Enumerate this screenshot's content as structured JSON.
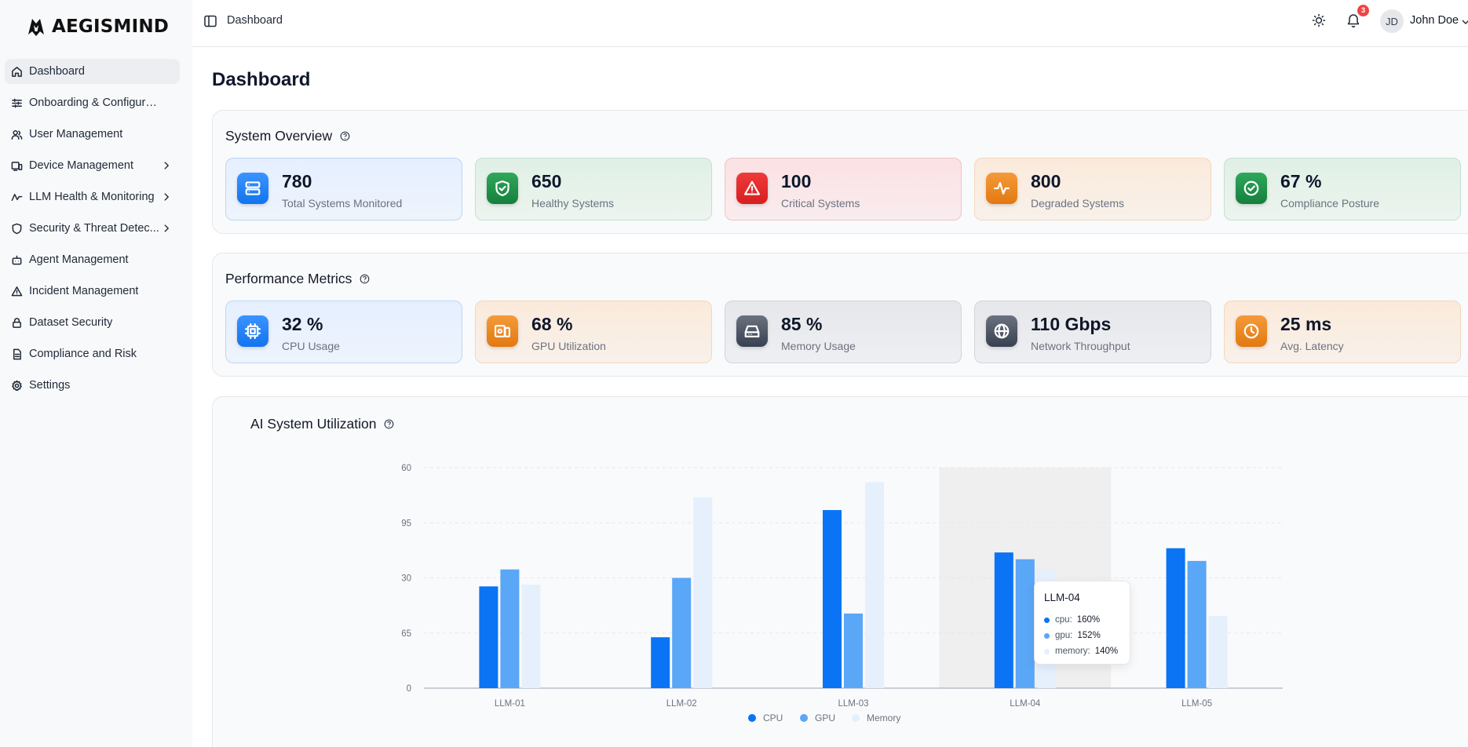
{
  "app": {
    "name": "AEGISMIND"
  },
  "sidebar": {
    "items": [
      {
        "label": "Dashboard",
        "icon": "home-icon",
        "active": true
      },
      {
        "label": "Onboarding & Configuration",
        "icon": "sliders-icon"
      },
      {
        "label": "User Management",
        "icon": "users-icon"
      },
      {
        "label": "Device Management",
        "icon": "devices-icon",
        "has_submenu": true
      },
      {
        "label": "LLM Health & Monitoring",
        "icon": "activity-icon",
        "has_submenu": true
      },
      {
        "label": "Security & Threat Detec...",
        "icon": "shield-icon",
        "has_submenu": true
      },
      {
        "label": "Agent Management",
        "icon": "bot-icon"
      },
      {
        "label": "Incident Management",
        "icon": "alert-triangle-icon"
      },
      {
        "label": "Dataset Security",
        "icon": "lock-icon"
      },
      {
        "label": "Compliance and Risk",
        "icon": "file-icon"
      },
      {
        "label": "Settings",
        "icon": "gear-icon"
      }
    ]
  },
  "header": {
    "breadcrumb": "Dashboard",
    "notification_count": "3",
    "user_initials": "JD",
    "user_name": "John Doe"
  },
  "page": {
    "title": "Dashboard"
  },
  "system_overview": {
    "title": "System Overview",
    "cards": [
      {
        "value": "780",
        "label": "Total Systems Monitored",
        "icon": "server-icon",
        "color": "#1374ef"
      },
      {
        "value": "650",
        "label": "Healthy Systems",
        "icon": "shield-check-icon",
        "color": "#15803d"
      },
      {
        "value": "100",
        "label": "Critical Systems",
        "icon": "alert-triangle-icon",
        "color": "#d81e1e"
      },
      {
        "value": "800",
        "label": "Degraded Systems",
        "icon": "pulse-icon",
        "color": "#e27910"
      },
      {
        "value": "67 %",
        "label": "Compliance Posture",
        "icon": "check-circle-icon",
        "color": "#15803d"
      }
    ]
  },
  "performance_metrics": {
    "title": "Performance Metrics",
    "cards": [
      {
        "value": "32 %",
        "label": "CPU Usage",
        "icon": "cpu-icon",
        "color": "#1374ef"
      },
      {
        "value": "68 %",
        "label": "GPU Utilization",
        "icon": "gpu-icon",
        "color": "#e27910"
      },
      {
        "value": "85 %",
        "label": "Memory Usage",
        "icon": "hard-drive-icon",
        "color": "#374151"
      },
      {
        "value": "110 Gbps",
        "label": "Network Throughput",
        "icon": "globe-icon",
        "color": "#374151"
      },
      {
        "value": "25 ms",
        "label": "Avg. Latency",
        "icon": "clock-icon",
        "color": "#e27910"
      }
    ]
  },
  "utilization": {
    "title": "AI System Utilization",
    "tooltip": {
      "title": "LLM-04",
      "rows": [
        {
          "key": "cpu:",
          "value": "160%",
          "color": "#0a74f5"
        },
        {
          "key": "gpu:",
          "value": "152%",
          "color": "#5aa6f7"
        },
        {
          "key": "memory:",
          "value": "140%",
          "color": "#e6f0fd"
        }
      ]
    }
  },
  "chart_data": {
    "type": "bar",
    "title": "AI System Utilization",
    "categories": [
      "LLM-01",
      "LLM-02",
      "LLM-03",
      "LLM-04",
      "LLM-05"
    ],
    "y_tick_labels": [
      "0",
      "65",
      "30",
      "95",
      "60"
    ],
    "ylim": [
      0,
      260
    ],
    "grid": true,
    "legend_position": "bottom",
    "highlighted_category": "LLM-04",
    "series": [
      {
        "name": "CPU",
        "color": "#0a74f5",
        "values": [
          120,
          60,
          210,
          160,
          165
        ]
      },
      {
        "name": "GPU",
        "color": "#5aa6f7",
        "values": [
          140,
          130,
          88,
          152,
          150
        ]
      },
      {
        "name": "Memory",
        "color": "#e6f0fd",
        "values": [
          122,
          225,
          243,
          140,
          85
        ]
      }
    ]
  }
}
